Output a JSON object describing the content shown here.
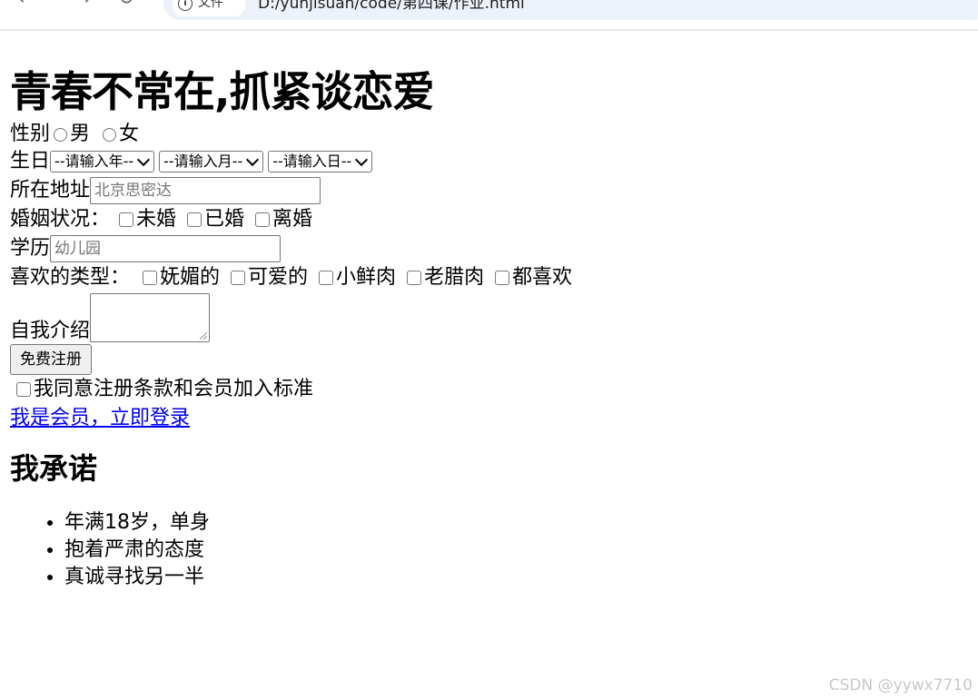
{
  "browser": {
    "site_chip_label": "文件",
    "site_chip_icon": "info-icon",
    "url": "D:/yunjisuan/code/第四课/作业.html"
  },
  "page": {
    "title": "青春不常在,抓紧谈恋爱",
    "gender": {
      "label": "性别",
      "options": [
        "男",
        "女"
      ]
    },
    "birthday": {
      "label": "生日",
      "year": "--请输入年--",
      "month": "--请输入月--",
      "day": "--请输入日--"
    },
    "address": {
      "label": "所在地址",
      "placeholder": "北京思密达"
    },
    "marital": {
      "label": "婚姻状况：",
      "options": [
        "未婚",
        "已婚",
        "离婚"
      ]
    },
    "education": {
      "label": "学历",
      "placeholder": "幼儿园"
    },
    "type": {
      "label": "喜欢的类型：",
      "options": [
        "妩媚的",
        "可爱的",
        "小鲜肉",
        "老腊肉",
        "都喜欢"
      ]
    },
    "intro": {
      "label": "自我介绍"
    },
    "register_button": "免费注册",
    "agree_label": "我同意注册条款和会员加入标准",
    "login_link": "我是会员，立即登录",
    "promise": {
      "title": "我承诺",
      "items": [
        "年满18岁，单身",
        "抱着严肃的态度",
        "真诚寻找另一半"
      ]
    }
  },
  "watermark": "CSDN @yywx7710"
}
